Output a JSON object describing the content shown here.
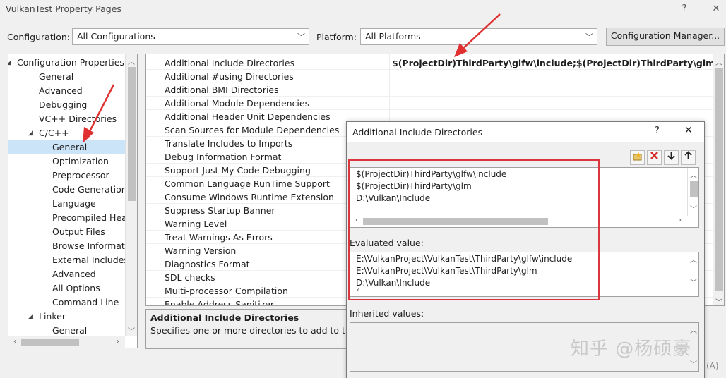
{
  "window": {
    "title": "VulkanTest Property Pages",
    "help": "?",
    "close": "✕"
  },
  "toolbar": {
    "config_label": "Configuration:",
    "config_value": "All Configurations",
    "platform_label": "Platform:",
    "platform_value": "All Platforms",
    "manager_button": "Configuration Manager..."
  },
  "tree": {
    "items": [
      {
        "label": "Configuration Properties",
        "exp": "◢"
      },
      {
        "label": "General"
      },
      {
        "label": "Advanced"
      },
      {
        "label": "Debugging"
      },
      {
        "label": "VC++ Directories"
      },
      {
        "label": "C/C++",
        "exp": "◢"
      },
      {
        "label": "General",
        "selected": true
      },
      {
        "label": "Optimization"
      },
      {
        "label": "Preprocessor"
      },
      {
        "label": "Code Generation"
      },
      {
        "label": "Language"
      },
      {
        "label": "Precompiled Heac"
      },
      {
        "label": "Output Files"
      },
      {
        "label": "Browse Informatic"
      },
      {
        "label": "External Includes"
      },
      {
        "label": "Advanced"
      },
      {
        "label": "All Options"
      },
      {
        "label": "Command Line"
      },
      {
        "label": "Linker",
        "exp": "◢"
      },
      {
        "label": "General"
      }
    ]
  },
  "grid": {
    "rows": [
      {
        "name": "Additional Include Directories",
        "value": "$(ProjectDir)ThirdParty\\glfw\\include;$(ProjectDir)ThirdParty\\glm;D:\\Vulk"
      },
      {
        "name": "Additional #using Directories",
        "value": ""
      },
      {
        "name": "Additional BMI Directories",
        "value": ""
      },
      {
        "name": "Additional Module Dependencies",
        "value": ""
      },
      {
        "name": "Additional Header Unit Dependencies",
        "value": ""
      },
      {
        "name": "Scan Sources for Module Dependencies",
        "value": ""
      },
      {
        "name": "Translate Includes to Imports",
        "value": ""
      },
      {
        "name": "Debug Information Format",
        "value": ""
      },
      {
        "name": "Support Just My Code Debugging",
        "value": ""
      },
      {
        "name": "Common Language RunTime Support",
        "value": ""
      },
      {
        "name": "Consume Windows Runtime Extension",
        "value": ""
      },
      {
        "name": "Suppress Startup Banner",
        "value": ""
      },
      {
        "name": "Warning Level",
        "value": ""
      },
      {
        "name": "Treat Warnings As Errors",
        "value": ""
      },
      {
        "name": "Warning Version",
        "value": ""
      },
      {
        "name": "Diagnostics Format",
        "value": ""
      },
      {
        "name": "SDL checks",
        "value": ""
      },
      {
        "name": "Multi-processor Compilation",
        "value": ""
      },
      {
        "name": "Enable Address Sanitizer",
        "value": ""
      }
    ]
  },
  "description": {
    "title": "Additional Include Directories",
    "text": "Specifies one or more directories to add to the"
  },
  "dialog": {
    "title": "Additional Include Directories",
    "help": "?",
    "close": "✕",
    "entries": [
      "$(ProjectDir)ThirdParty\\glfw\\include",
      "$(ProjectDir)ThirdParty\\glm",
      "D:\\Vulkan\\Include"
    ],
    "evaluated_label": "Evaluated value:",
    "evaluated": [
      "E:\\VulkanProject\\VulkanTest\\ThirdParty\\glfw\\include",
      "E:\\VulkanProject\\VulkanTest\\ThirdParty\\glm",
      "D:\\Vulkan\\Include"
    ],
    "inherited_label": "Inherited values:"
  },
  "apply_partial": "(A)",
  "watermark": "知乎 @杨硕豪",
  "colors": {
    "annotation_red": "#d9363e",
    "selection": "#cce4f7"
  }
}
